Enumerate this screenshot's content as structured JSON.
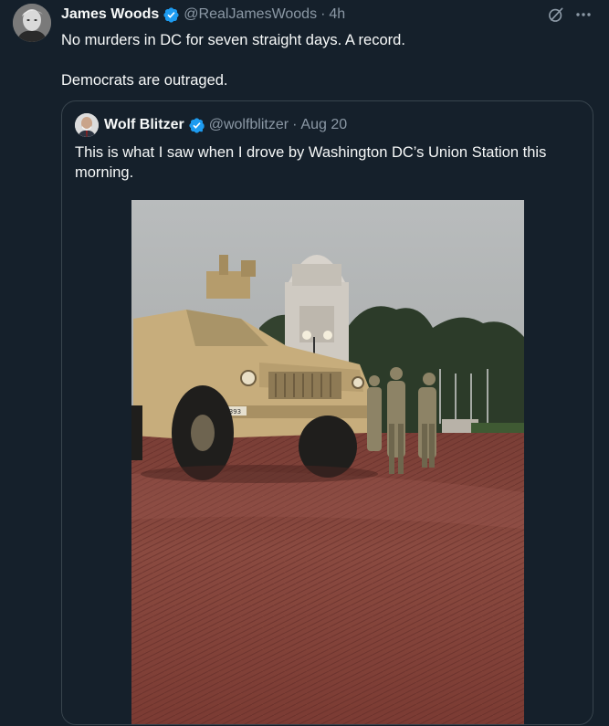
{
  "tweet": {
    "author_name": "James Woods",
    "author_handle": "@RealJamesWoods",
    "separator": "·",
    "time": "4h",
    "text_line1": "No murders in DC for seven straight days. A record.",
    "text_line2": "Democrats are outraged."
  },
  "quoted_tweet": {
    "author_name": "Wolf Blitzer",
    "author_handle": "@wolfblitzer",
    "separator": "·",
    "time": "Aug 20",
    "text": "This is what I saw when I drove by Washington DC’s Union Station this morning.",
    "media": {
      "vehicle_plate": "37393"
    }
  },
  "icons": {
    "verified": "verified-badge-icon",
    "grok": "grok-icon",
    "more": "more-options-icon"
  },
  "colors": {
    "background": "#15202b",
    "verified_blue": "#1d9bf0",
    "secondary_text": "#8b98a5",
    "border": "#38444d"
  }
}
